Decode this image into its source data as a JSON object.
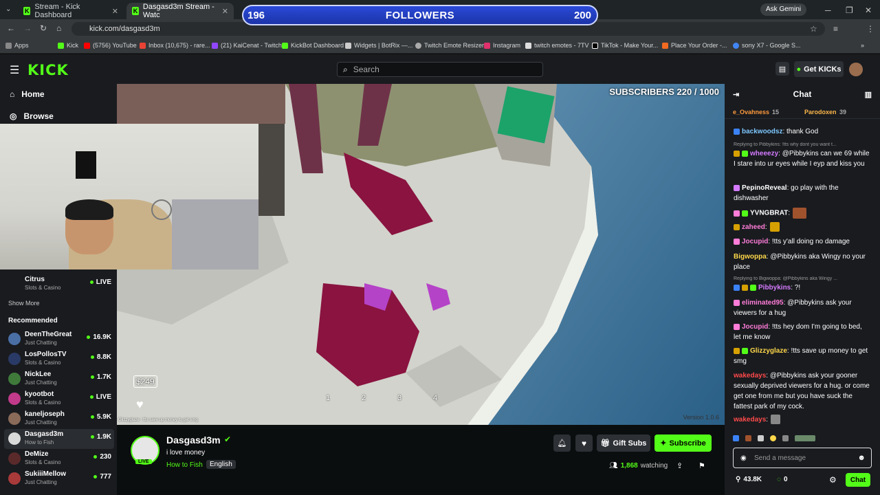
{
  "browser": {
    "tabs": [
      {
        "label": "Stream - Kick Dashboard"
      },
      {
        "label": "Dasgasd3m Stream - Watc"
      }
    ],
    "url": "kick.com/dasgasd3m",
    "ask_gemini": "Ask Gemini",
    "bookmarks": [
      {
        "label": "Apps"
      },
      {
        "label": "Kick"
      },
      {
        "label": "(5756) YouTube"
      },
      {
        "label": "Inbox (10,675) - rare..."
      },
      {
        "label": "(21) KaiCenat - Twitch"
      },
      {
        "label": "KickBot Dashboard"
      },
      {
        "label": "Widgets | BotRix —..."
      },
      {
        "label": "Twitch Emote Resizer"
      },
      {
        "label": "Instagram"
      },
      {
        "label": "twitch emotes - 7TV"
      },
      {
        "label": "TikTok - Make Your..."
      },
      {
        "label": "Place Your Order -..."
      },
      {
        "label": "sony X7 - Google S..."
      }
    ]
  },
  "followers_goal": {
    "current": "196",
    "label": "FOLLOWERS",
    "target": "200"
  },
  "topbar": {
    "logo": "KICK",
    "search_placeholder": "Search",
    "get_kicks": "Get KICKs"
  },
  "sidebar": {
    "home": "Home",
    "browse": "Browse",
    "following": [
      {
        "name": "Citrus",
        "category": "Slots & Casino",
        "value": "LIVE"
      }
    ],
    "show_more": "Show More",
    "recommended_title": "Recommended",
    "recommended": [
      {
        "name": "DeenTheGreat",
        "category": "Just Chatting",
        "value": "16.9K"
      },
      {
        "name": "LosPollosTV",
        "category": "Slots & Casino",
        "value": "8.8K"
      },
      {
        "name": "NickLee",
        "category": "Just Chatting",
        "value": "1.7K"
      },
      {
        "name": "kyootbot",
        "category": "Slots & Casino",
        "value": "LIVE"
      },
      {
        "name": "kaneljoseph",
        "category": "Just Chatting",
        "value": "5.9K"
      },
      {
        "name": "Dasgasd3m",
        "category": "How to Fish",
        "value": "1.9K"
      },
      {
        "name": "DeMize",
        "category": "Slots & Casino",
        "value": "230"
      },
      {
        "name": "SukiiiMellow",
        "category": "Just Chatting",
        "value": "777"
      }
    ]
  },
  "video": {
    "subscribers": "SUBSCRIBERS 220 / 1000",
    "price": "$249",
    "hotbar": [
      "1",
      "2",
      "3",
      "4"
    ],
    "version": "Version  1.0.6",
    "overlay_chat": "Glizzyglaze : !tts save up money to get smg"
  },
  "channel": {
    "name": "Dasgasd3m",
    "title": "i love money",
    "category": "How to Fish",
    "language": "English",
    "live": "LIVE",
    "gift_subs": "Gift Subs",
    "subscribe": "Subscribe",
    "watching": "1,868",
    "watching_label": "watching"
  },
  "chat": {
    "title": "Chat",
    "pinned": [
      {
        "user": "e_Ovahness",
        "count": "15"
      },
      {
        "user": "Parodoxen",
        "count": "39"
      }
    ],
    "messages": [
      {
        "user": "backwoodsz",
        "color": "#7ec8ff",
        "text": " thank God"
      },
      {
        "reply": "Replying to Pibbykins: !tts why dont you want t..."
      },
      {
        "user": "wheeezy",
        "color": "#d57bff",
        "text": " @Pibbykins can we 69 while I stare into ur eyes while I eyp and kiss you"
      },
      {
        "user": "PepinoReveal",
        "color": "#ffffff",
        "text": " go play with the dishwasher"
      },
      {
        "user": "YVNGBRAT",
        "color": "#ffffff",
        "text": ""
      },
      {
        "user": "zaheed",
        "color": "#ff7dd8",
        "text": ""
      },
      {
        "user": "Jocupid",
        "color": "#ff7dd8",
        "text": " !tts y'all doing no damage"
      },
      {
        "user": "Bigwoppa",
        "color": "#ffd84a",
        "text": " @Pibbykins aka Wingy no your place"
      },
      {
        "reply": "Replying to Bigwoppa: @Pibbykins aka Wingy ..."
      },
      {
        "user": "Pibbykins",
        "color": "#d57bff",
        "text": " ?!"
      },
      {
        "user": "eliminated95",
        "color": "#ff7dd8",
        "text": " @Pibbykins ask your viewers for a hug"
      },
      {
        "user": "Jocupid",
        "color": "#ff7dd8",
        "text": " !tts hey dom I'm going to bed, let me know"
      },
      {
        "user": "Glizzyglaze",
        "color": "#ffd84a",
        "text": " !tts save up money to get smg"
      },
      {
        "user": "wakedays",
        "color": "#ff4a4a",
        "text": " @Pibbykins ask your gooner sexually deprived viewers for a hug. or come get one from me but you have suck the fattest park of my cock."
      },
      {
        "user": "wakedays",
        "color": "#ff4a4a",
        "text": ""
      }
    ],
    "input_placeholder": "Send a message",
    "kicks": "43.8K",
    "points": "0",
    "send": "Chat"
  }
}
